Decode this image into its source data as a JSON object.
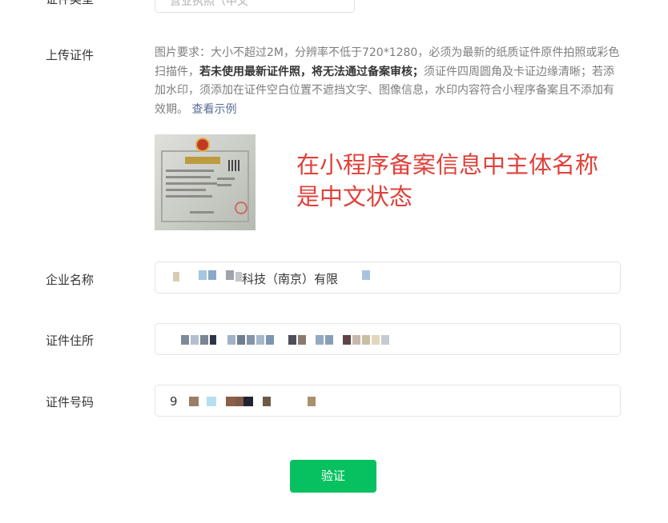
{
  "top_row": {
    "label": "证件类型",
    "select_text": "营业执照（中文"
  },
  "upload": {
    "label": "上传证件",
    "desc_part1": "图片要求：大小不超过2M，分辨率不低于720*1280，必须为最新的纸质证件原件拍照或彩色扫描件，",
    "desc_bold": "若未使用最新证件照，将无法通过备案审核；",
    "desc_part2": "须证件四周圆角及卡证边缘清晰；若添加水印，须添加在证件空白位置不遮挡文字、图像信息，水印内容符合小程序备案且不添加有效期。",
    "example_link": "查看示例"
  },
  "annotation": {
    "line1": "在小程序备案信息中主体名称",
    "line2": "是中文状态"
  },
  "company": {
    "label": "企业名称",
    "value_visible": "科技（南京）有限"
  },
  "address": {
    "label": "证件住所"
  },
  "id_number": {
    "label": "证件号码",
    "value_visible": "9"
  },
  "actions": {
    "verify_label": "验证"
  },
  "colors": {
    "primary_green": "#07c160",
    "link": "#576b95",
    "annotation_red": "#e0413a"
  }
}
